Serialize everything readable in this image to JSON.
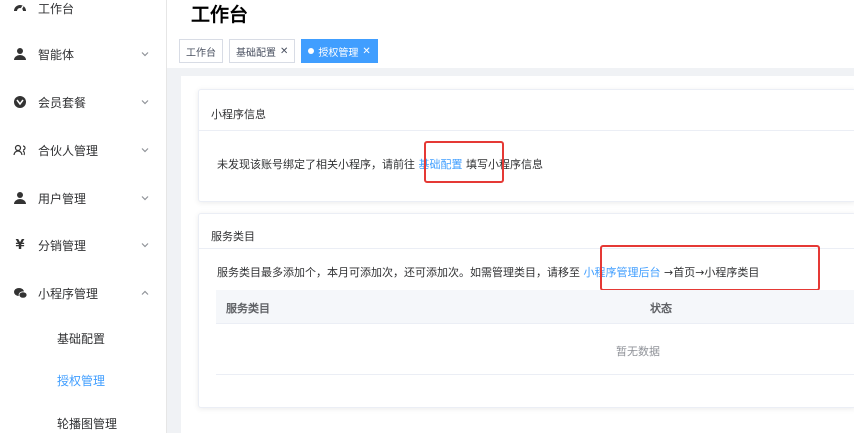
{
  "header": {
    "title": "工作台"
  },
  "tabs": [
    {
      "label": "工作台"
    },
    {
      "label": "基础配置"
    },
    {
      "label": "授权管理"
    }
  ],
  "sidebar": {
    "items": [
      {
        "label": "工作台",
        "icon": "dashboard-icon"
      },
      {
        "label": "智能体",
        "icon": "user-icon"
      },
      {
        "label": "会员套餐",
        "icon": "vip-icon"
      },
      {
        "label": "合伙人管理",
        "icon": "partner-icon"
      },
      {
        "label": "用户管理",
        "icon": "user-icon"
      },
      {
        "label": "分销管理",
        "icon": "yen-icon"
      },
      {
        "label": "小程序管理",
        "icon": "wechat-icon"
      }
    ],
    "sub_items": [
      {
        "label": "基础配置"
      },
      {
        "label": "授权管理"
      },
      {
        "label": "轮播图管理"
      }
    ]
  },
  "mini_program_card": {
    "title": "小程序信息",
    "text_before": "未发现该账号绑定了相关小程序，请前往",
    "link": "基础配置",
    "text_after": "填写小程序信息"
  },
  "service_card": {
    "title": "服务类目",
    "text_before": "服务类目最多添加个，本月可添加次，还可添加次。如需管理类目，请移至",
    "link": "小程序管理后台",
    "text_after": "→首页→小程序类目",
    "columns": [
      "服务类目",
      "状态"
    ],
    "empty_text": "暂无数据"
  },
  "colors": {
    "accent": "#409eff",
    "highlight": "#e53935"
  }
}
